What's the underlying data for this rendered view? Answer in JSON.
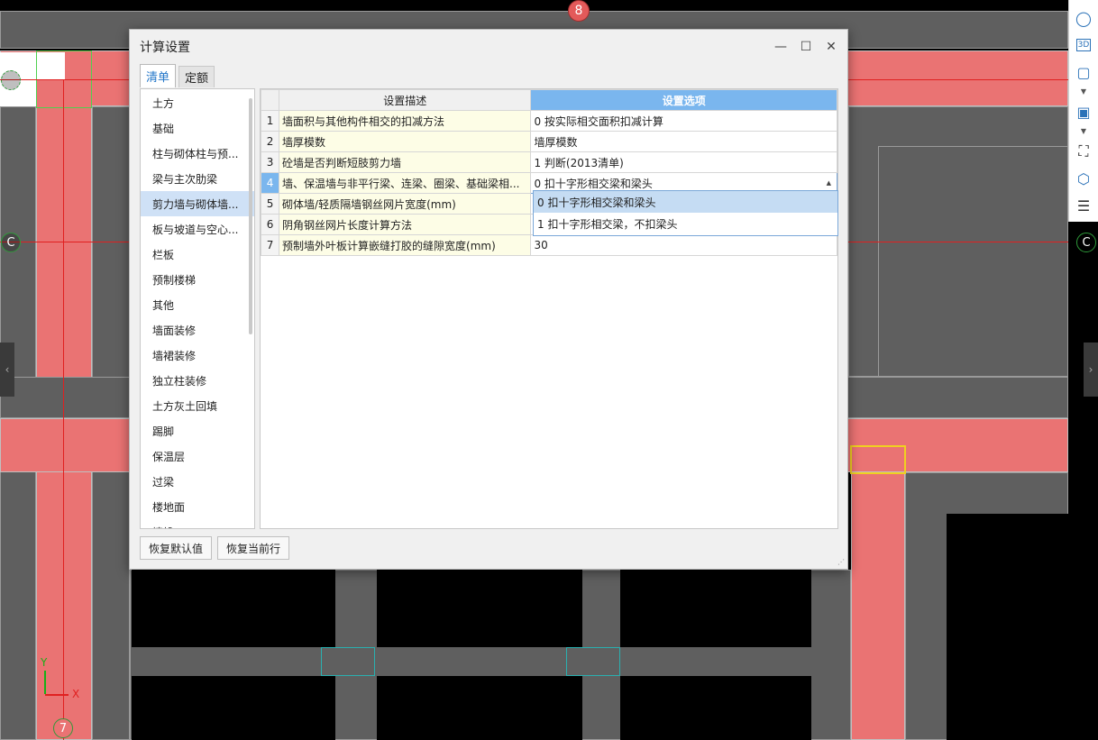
{
  "canvas": {
    "axis_labels": {
      "c_left": "C",
      "c_right": "C",
      "seven": "7",
      "eight": "8"
    },
    "coord_axes": {
      "x": "X",
      "y": "Y"
    }
  },
  "toolbar": {
    "icons": [
      "sphere-icon",
      "view-3d-icon",
      "cube-icon",
      "box-solid-icon",
      "fullscreen-icon",
      "view-cube-icon",
      "properties-icon"
    ],
    "glyph_3d": "3D"
  },
  "dialog": {
    "title": "计算设置",
    "tabs": [
      "清单",
      "定额"
    ],
    "categories": [
      "土方",
      "基础",
      "柱与砌体柱与预...",
      "梁与主次肋梁",
      "剪力墙与砌体墙...",
      "板与坡道与空心...",
      "栏板",
      "预制楼梯",
      "其他",
      "墙面装修",
      "墙裙装修",
      "独立柱装修",
      "土方灰土回填",
      "踢脚",
      "保温层",
      "过梁",
      "楼地面",
      "墙垛"
    ],
    "selected_category": "剪力墙与砌体墙...",
    "table": {
      "headers": {
        "desc": "设置描述",
        "opt": "设置选项"
      },
      "rows": [
        {
          "num": "1",
          "desc": "墙面积与其他构件相交的扣减方法",
          "opt": "0 按实际相交面积扣减计算"
        },
        {
          "num": "2",
          "desc": "墙厚模数",
          "opt": "墙厚模数"
        },
        {
          "num": "3",
          "desc": "砼墙是否判断短肢剪力墙",
          "opt": "1 判断(2013清单)"
        },
        {
          "num": "4",
          "desc": "墙、保温墙与非平行梁、连梁、圈梁、基础梁相...",
          "opt": "0 扣十字形相交梁和梁头"
        },
        {
          "num": "5",
          "desc": "砌体墙/轻质隔墙钢丝网片宽度(mm)",
          "opt": ""
        },
        {
          "num": "6",
          "desc": "阴角钢丝网片长度计算方法",
          "opt": ""
        },
        {
          "num": "7",
          "desc": "预制墙外叶板计算嵌缝打胶的缝隙宽度(mm)",
          "opt": "30"
        }
      ],
      "active_row": "4"
    },
    "dropdown_options": [
      "0 扣十字形相交梁和梁头",
      "1 扣十字形相交梁，不扣梁头"
    ],
    "buttons": {
      "restore_default": "恢复默认值",
      "restore_row": "恢复当前行"
    }
  },
  "colors": {
    "accent": "#7ab6ee",
    "tab_active": "#2477c9",
    "wall_red": "#ea7373",
    "wall_gray": "#5f5f5f"
  }
}
